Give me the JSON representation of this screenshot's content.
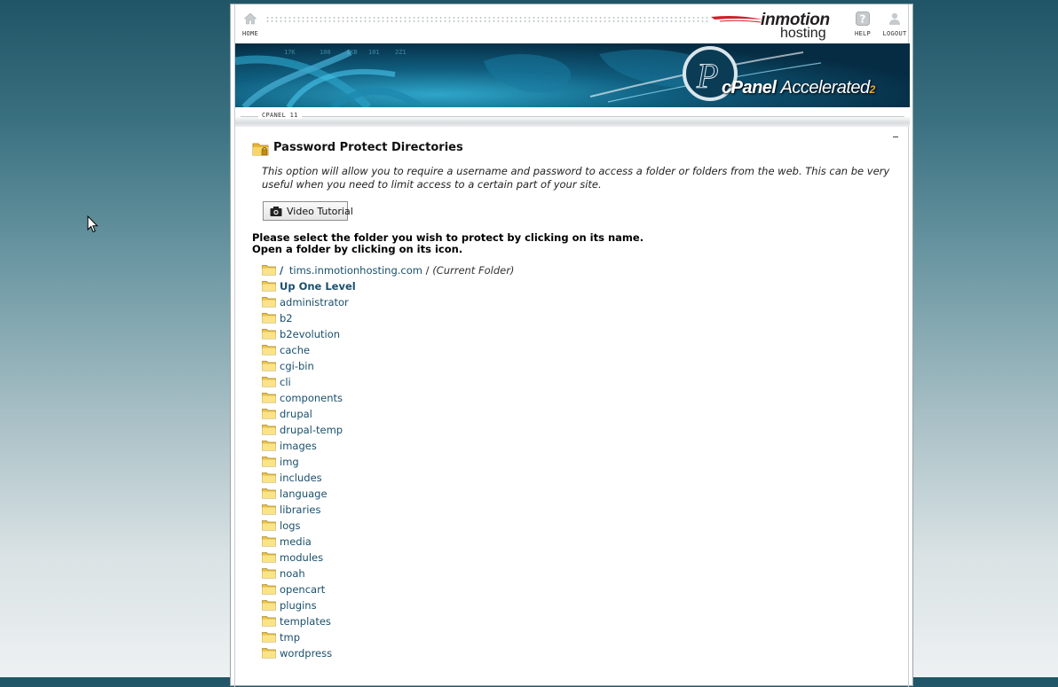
{
  "header": {
    "home_label": "HOME",
    "help_label": "HELP",
    "logout_label": "LOGOUT",
    "brand_name": "inmotion",
    "brand_sub": "hosting",
    "home_icon": "home-icon",
    "help_icon": "help-icon",
    "logout_icon": "user-icon"
  },
  "banner": {
    "product": "cPanel",
    "product_suffix": "Accelerated",
    "product_version_mark": "2"
  },
  "version": "CPANEL 11",
  "page": {
    "title": "Password Protect Directories",
    "intro": "This option will allow you to require a username and password to access a folder or folders from the web. This can be very useful when you need to limit access to a certain part of your site.",
    "video_button": "Video Tutorial",
    "instruction_line1": "Please select the folder you wish to protect by clicking on its name.",
    "instruction_line2": "Open a folder by clicking on its icon."
  },
  "browser": {
    "root_slash": "/",
    "domain": "tims.inmotionhosting.com",
    "separator": "/",
    "current_label": "(Current Folder)",
    "up_level": "Up One Level",
    "folders": [
      "administrator",
      "b2",
      "b2evolution",
      "cache",
      "cgi-bin",
      "cli",
      "components",
      "drupal",
      "drupal-temp",
      "images",
      "img",
      "includes",
      "language",
      "libraries",
      "logs",
      "media",
      "modules",
      "noah",
      "opencart",
      "plugins",
      "templates",
      "tmp",
      "wordpress"
    ]
  },
  "colors": {
    "link": "#1b4f6b",
    "folder": "#f3d36b",
    "accent_orange": "#f2a23b",
    "brand_red": "#d32027"
  }
}
